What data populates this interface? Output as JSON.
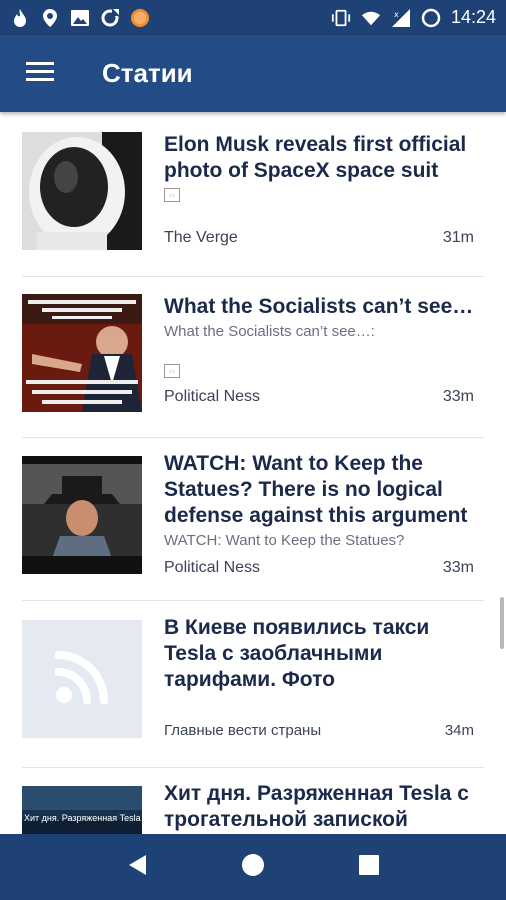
{
  "status_bar": {
    "time": "14:24",
    "icons": [
      "flame-icon",
      "location-pin-icon",
      "image-icon",
      "sync-icon",
      "badge-icon",
      "vibrate-icon",
      "wifi-icon",
      "signal-icon",
      "battery-icon"
    ]
  },
  "app_bar": {
    "title": "Статии",
    "menu_icon": "hamburger-menu-icon"
  },
  "articles": [
    {
      "headline": "Elon Musk reveals first official photo of SpaceX space suit",
      "summary": "",
      "source": "The Verge",
      "age": "31m",
      "thumbnail": "spacesuit-photo"
    },
    {
      "headline": "What the Socialists can’t see…",
      "summary": "What the Socialists can’t see…:",
      "source": "Political Ness",
      "age": "33m",
      "thumbnail": "meme-photo"
    },
    {
      "headline": "WATCH: Want to Keep the Statues? There is no logical defense against this argument",
      "summary": "WATCH: Want to Keep the Statues?",
      "source": "Political Ness",
      "age": "33m",
      "thumbnail": "video-photo"
    },
    {
      "headline": "В Киеве появились такси Tesla с заоблачными тарифами. Фото",
      "summary": "",
      "source": "Главные вести страны",
      "age": "34m",
      "thumbnail": "rss-placeholder"
    },
    {
      "headline": "Хит дня. Разряженная Tesla с трогательной запиской",
      "summary": "",
      "source": "",
      "age": "",
      "thumbnail": "tesla-photo",
      "thumb_caption": "Хит дня. Разряженная Tesla"
    }
  ],
  "nav_bar": {
    "back_icon": "back-triangle-icon",
    "home_icon": "home-circle-icon",
    "recents_icon": "recents-square-icon"
  },
  "colors": {
    "status_bar": "#1e4176",
    "app_bar": "#234c87",
    "headline": "#1b2a4a",
    "placeholder": "#e4e9f2"
  }
}
